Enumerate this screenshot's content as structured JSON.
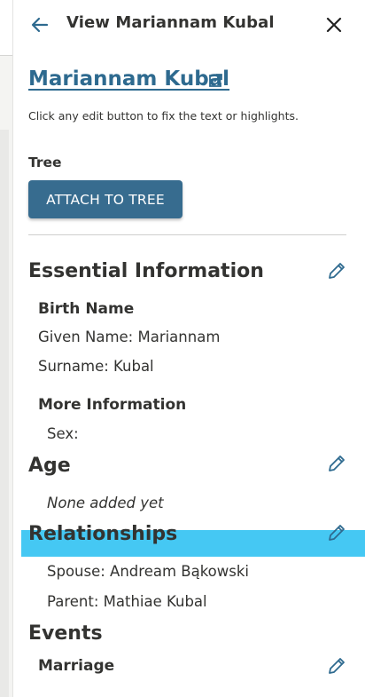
{
  "header": {
    "title": "View Mariannam Kubal"
  },
  "person": {
    "name": "Mariannam Kubal"
  },
  "hint": "Click any edit button to fix the text or highlights.",
  "tree": {
    "label": "Tree",
    "attach_label": "ATTACH TO TREE"
  },
  "essential": {
    "title": "Essential Information",
    "birth_name_label": "Birth Name",
    "given_name": "Given Name: Mariannam",
    "surname": "Surname: Kubal",
    "more_info_label": "More Information",
    "sex": "Sex:"
  },
  "age": {
    "title": "Age",
    "value": "None added yet"
  },
  "relationships": {
    "title": "Relationships",
    "items": [
      "Spouse: Andream Bąkowski",
      "Parent: Mathiae Kubal"
    ]
  },
  "events": {
    "title": "Events",
    "marriage_label": "Marriage"
  },
  "colors": {
    "accent": "#2e6a8f",
    "button": "#376c8f",
    "highlight": "#45c8f3",
    "text": "#333331"
  }
}
